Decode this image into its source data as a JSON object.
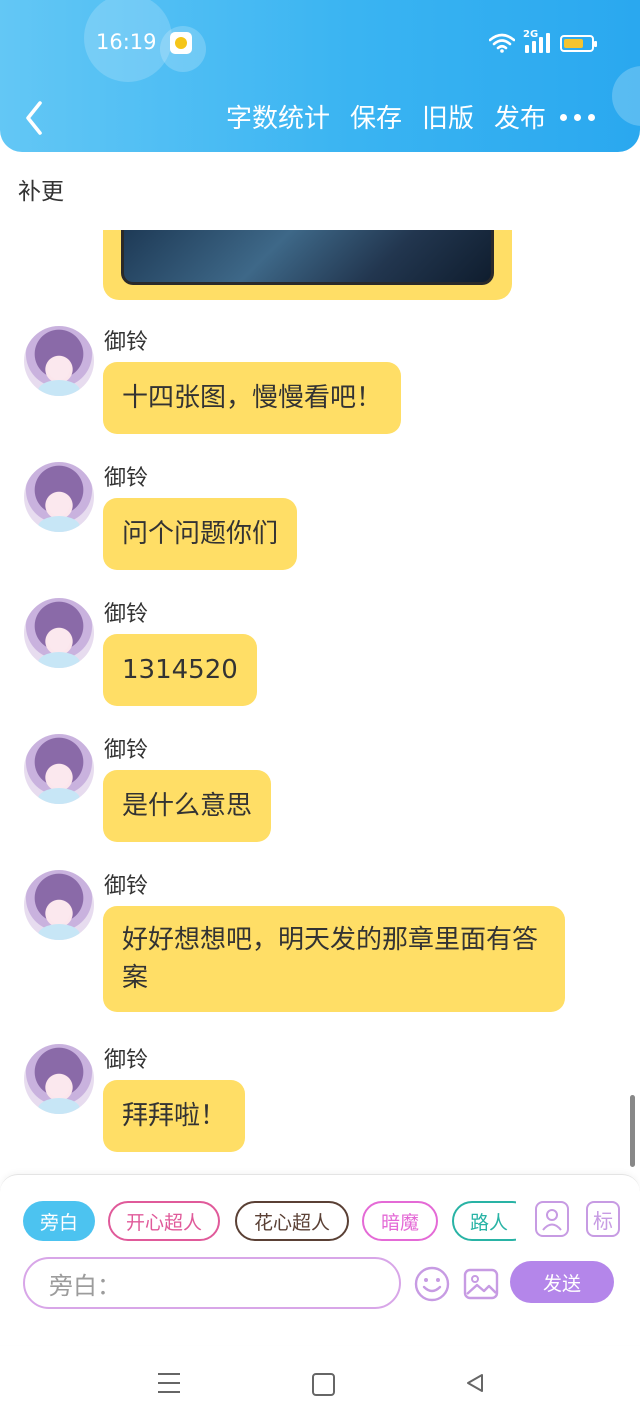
{
  "status_bar": {
    "time": "16:19",
    "network": "2G"
  },
  "header": {
    "actions": [
      "字数统计",
      "保存",
      "旧版",
      "发布"
    ]
  },
  "chapter": {
    "title": "补更"
  },
  "messages": [
    {
      "name": "御铃",
      "text": "十四张图，慢慢看吧！"
    },
    {
      "name": "御铃",
      "text": "问个问题你们"
    },
    {
      "name": "御铃",
      "text": "1314520"
    },
    {
      "name": "御铃",
      "text": "是什么意思"
    },
    {
      "name": "御铃",
      "text": "好好想想吧，明天发的那章里面有答案"
    },
    {
      "name": "御铃",
      "text": "拜拜啦！"
    }
  ],
  "panel": {
    "roles": [
      "旁白",
      "开心超人",
      "花心超人",
      "暗魔",
      "路人"
    ],
    "mark_label": "标",
    "input_placeholder": "旁白：",
    "send_label": "发送"
  },
  "colors": {
    "header_blue": "#3ab4f2",
    "bubble_yellow": "#ffde66",
    "send_purple": "#b486ea"
  }
}
